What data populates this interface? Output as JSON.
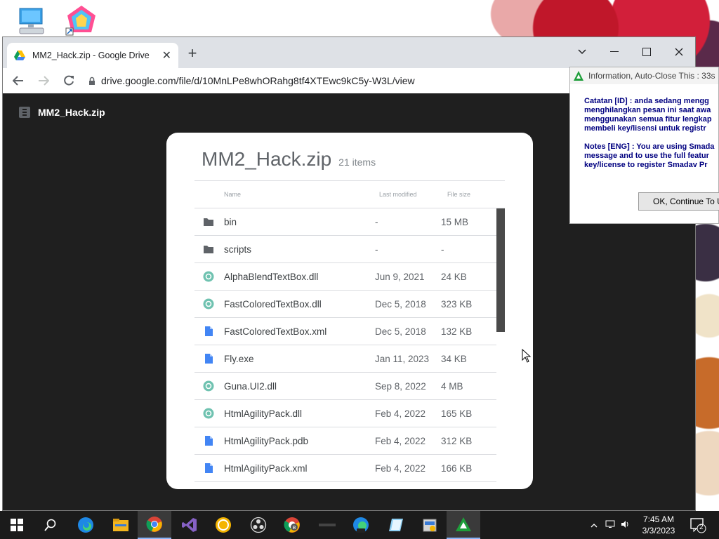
{
  "browser": {
    "tab_title": "MM2_Hack.zip - Google Drive",
    "url": "drive.google.com/file/d/10MnLPe8whORahg8tf4XTEwc9kC5y-W3L/view"
  },
  "viewer": {
    "file_name": "MM2_Hack.zip"
  },
  "card": {
    "title": "MM2_Hack.zip",
    "count": "21 items",
    "columns": {
      "name": "Name",
      "modified": "Last modified",
      "size": "File size"
    },
    "rows": [
      {
        "name": "bin",
        "modified": "-",
        "size": "15 MB",
        "icon": "folder-icon"
      },
      {
        "name": "scripts",
        "modified": "-",
        "size": "-",
        "icon": "folder-icon"
      },
      {
        "name": "AlphaBlendTextBox.dll",
        "modified": "Jun 9, 2021",
        "size": "24 KB",
        "icon": "dll-icon"
      },
      {
        "name": "FastColoredTextBox.dll",
        "modified": "Dec 5, 2018",
        "size": "323 KB",
        "icon": "dll-icon"
      },
      {
        "name": "FastColoredTextBox.xml",
        "modified": "Dec 5, 2018",
        "size": "132 KB",
        "icon": "file-icon"
      },
      {
        "name": "Fly.exe",
        "modified": "Jan 11, 2023",
        "size": "34 KB",
        "icon": "file-icon"
      },
      {
        "name": "Guna.UI2.dll",
        "modified": "Sep 8, 2022",
        "size": "4 MB",
        "icon": "dll-icon"
      },
      {
        "name": "HtmlAgilityPack.dll",
        "modified": "Feb 4, 2022",
        "size": "165 KB",
        "icon": "dll-icon"
      },
      {
        "name": "HtmlAgilityPack.pdb",
        "modified": "Feb 4, 2022",
        "size": "312 KB",
        "icon": "file-icon"
      },
      {
        "name": "HtmlAgilityPack.xml",
        "modified": "Feb 4, 2022",
        "size": "166 KB",
        "icon": "file-icon"
      }
    ]
  },
  "smadav": {
    "title": "Information, Auto-Close This : 33s",
    "lines_id": [
      "Catatan [ID] : anda sedang mengg",
      "menghilangkan pesan ini saat awa",
      "menggunakan semua fitur lengkap",
      "membeli key/lisensi untuk registr"
    ],
    "lines_en": [
      "Notes [ENG] : You are using Smada",
      "message and to use the full featur",
      "key/license to register Smadav Pr"
    ],
    "button": "OK, Continue To Us"
  },
  "taskbar": {
    "time": "7:45 AM",
    "date": "3/3/2023",
    "notifications": "2"
  },
  "colors": {
    "folder": "#5f6368",
    "dll": "#6fc2b0",
    "file": "#4285f4",
    "smadav_text": "#000080"
  }
}
